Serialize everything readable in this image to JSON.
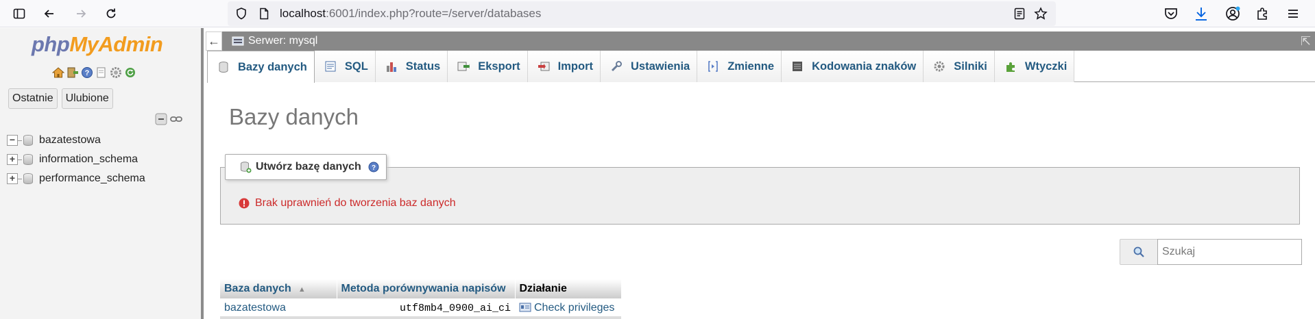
{
  "browser": {
    "url_host": "localhost",
    "url_rest": ":6001/index.php?route=/server/databases"
  },
  "nav": {
    "logo_php": "php",
    "logo_myadmin": "MyAdmin",
    "tabs": [
      "Ostatnie",
      "Ulubione"
    ],
    "databases": [
      {
        "name": "bazatestowa",
        "expander": "−"
      },
      {
        "name": "information_schema",
        "expander": "+"
      },
      {
        "name": "performance_schema",
        "expander": "+"
      }
    ]
  },
  "server_bar": {
    "back": "←",
    "label": "Serwer: mysql",
    "collapse": "⇱"
  },
  "tabs": [
    {
      "label": "Bazy danych",
      "icon": "databases-icon",
      "active": true
    },
    {
      "label": "SQL",
      "icon": "sql-icon"
    },
    {
      "label": "Status",
      "icon": "status-icon"
    },
    {
      "label": "Eksport",
      "icon": "export-icon"
    },
    {
      "label": "Import",
      "icon": "import-icon"
    },
    {
      "label": "Ustawienia",
      "icon": "settings-wrench-icon"
    },
    {
      "label": "Zmienne",
      "icon": "variables-icon"
    },
    {
      "label": "Kodowania znaków",
      "icon": "charset-icon"
    },
    {
      "label": "Silniki",
      "icon": "engines-icon"
    },
    {
      "label": "Wtyczki",
      "icon": "plugins-icon"
    }
  ],
  "main": {
    "title": "Bazy danych",
    "create": {
      "legend": "Utwórz bazę danych",
      "error": "Brak uprawnień do tworzenia baz danych"
    },
    "search": {
      "placeholder": "Szukaj"
    },
    "table": {
      "headers": [
        "Baza danych",
        "Metoda porównywania napisów",
        "Działanie"
      ],
      "sort_indicator": "▲",
      "rows": [
        {
          "name": "bazatestowa",
          "collation": "utf8mb4_0900_ai_ci",
          "action": "Check privileges"
        }
      ]
    }
  },
  "colors": {
    "link": "#235a81",
    "error": "#cc2a2a",
    "server_bar": "#888888",
    "logo_php": "#6c78af",
    "logo_myadmin": "#f29c1f"
  }
}
